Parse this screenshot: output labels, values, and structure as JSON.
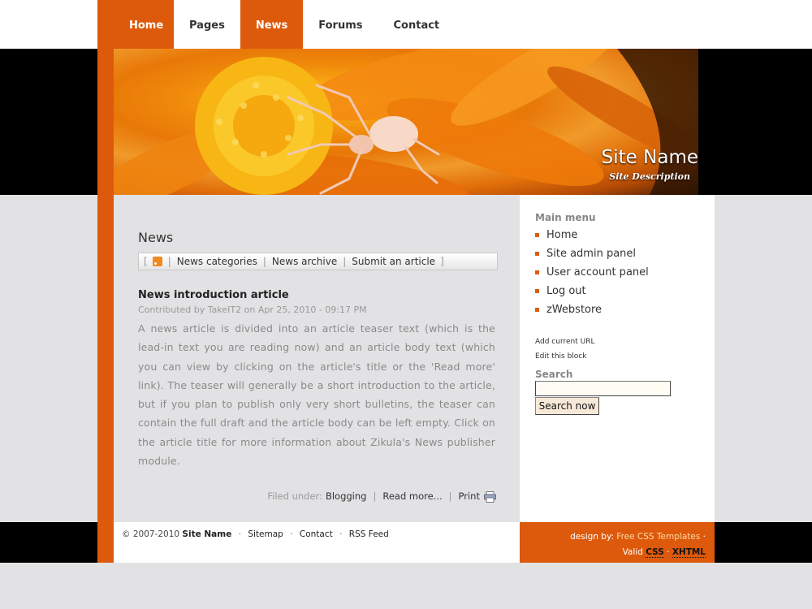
{
  "nav": {
    "items": [
      {
        "label": "Home",
        "active": true
      },
      {
        "label": "Pages",
        "active": false
      },
      {
        "label": "News",
        "active": true
      },
      {
        "label": "Forums",
        "active": false
      },
      {
        "label": "Contact",
        "active": false
      }
    ]
  },
  "header": {
    "site_name": "Site Name",
    "site_description": "Site Description"
  },
  "news": {
    "title": "News",
    "links": {
      "open_bracket": "[",
      "categories": "News categories",
      "archive": "News archive",
      "submit": "Submit an article",
      "close_bracket": "]",
      "separator": "|"
    },
    "article": {
      "title": "News introduction article",
      "meta": "Contributed by TakeIT2 on Apr 25, 2010 - 09:17 PM",
      "body": "A news article is divided into an article teaser text (which is the lead-in text you are reading now) and an article body text (which you can view by clicking on the article's title or the 'Read more' link). The teaser will generally be a short introduction to the article, but if you plan to publish only very short bulletins, the teaser can contain the full draft and the article body can be left empty. Click on the article title for more information about Zikula's News publisher module.",
      "filed_under_label": "Filed under:",
      "category": "Blogging",
      "read_more": "Read more...",
      "print": "Print"
    }
  },
  "sidebar": {
    "main_menu_title": "Main menu",
    "menu": [
      "Home",
      "Site admin panel",
      "User account panel",
      "Log out",
      "zWebstore"
    ],
    "add_current_url": "Add current URL",
    "edit_block": "Edit this block",
    "search_title": "Search",
    "search_button": "Search now"
  },
  "footer": {
    "copyright": "© 2007-2010",
    "site_name": "Site Name",
    "links": [
      "Sitemap",
      "Contact",
      "RSS Feed"
    ],
    "design_by": "design by:",
    "designer": "Free CSS Templates",
    "valid_label": "Valid",
    "valid_css": "CSS",
    "valid_xhtml": "XHTML"
  },
  "colors": {
    "accent": "#dd5a0c",
    "background": "#e2e2e4"
  }
}
